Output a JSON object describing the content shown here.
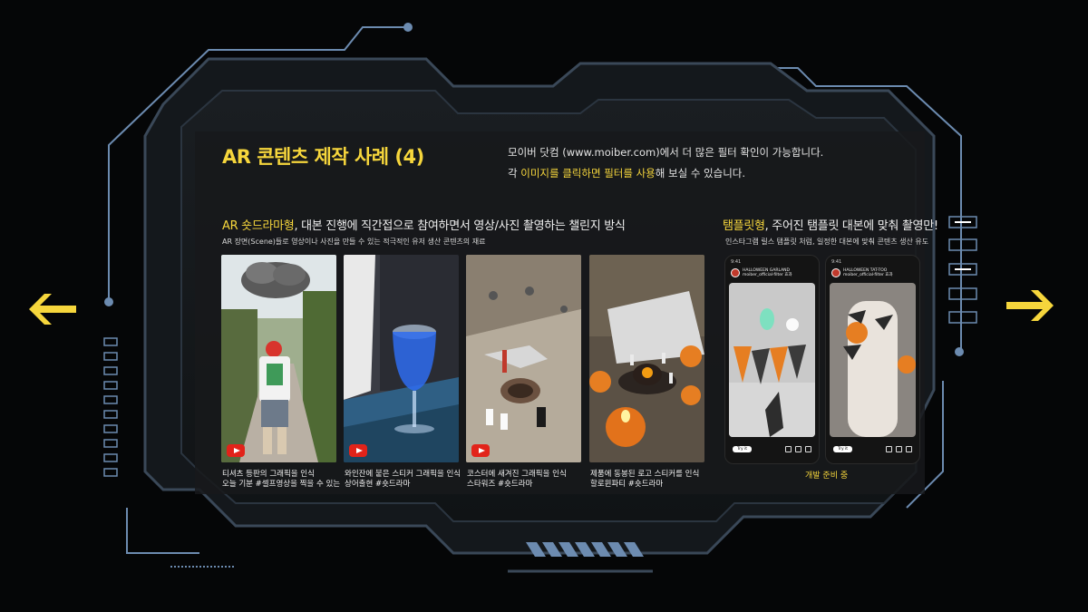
{
  "slide": {
    "title": "AR 콘텐츠 제작 사례 (4)",
    "header_line1": "모이버 닷컴 (www.moiber.com)에서 더 많은 필터 확인이 가능합니다.",
    "header_line2_prefix": "각 ",
    "header_line2_highlight": "이미지를 클릭하면 필터를 사용",
    "header_line2_suffix": "해 보실 수 있습니다."
  },
  "left_section": {
    "title_highlight": "AR 숏드라마형",
    "title_rest": ", 대본 진행에 직간접으로 참여하면서 영상/사진 촬영하는 챌린지 방식",
    "subtitle": "AR 장면(Scene)들로 영상이나 사진을 만들 수 있는 적극적인 유저 생산 콘텐츠의 재료",
    "cards": [
      {
        "caption_line1": "티셔츠 등판의 그래픽을 인식",
        "caption_line2": "오늘 기분 #셀프영상을 찍을 수 있는"
      },
      {
        "caption_line1": "와인잔에 붙은 스티커 그래픽을 인식",
        "caption_line2": "상어출현 #숏드라마"
      },
      {
        "caption_line1": "코스터에 새겨진 그래픽을 인식",
        "caption_line2": "스타워즈 #숏드라마"
      },
      {
        "caption_line1": "제품에 동봉된 로고 스티커를 인식",
        "caption_line2": "할로윈파티 #숏드라마"
      }
    ]
  },
  "right_section": {
    "title_highlight": "탬플릿형",
    "title_rest": ", 주어진 탬플릿 대본에 맞춰 촬영만!",
    "subtitle": "인스타그램 릴스 탬플릿 처럼, 일정한 대본에 맞춰 콘텐츠 생산 유도",
    "phones": [
      {
        "time": "9:41",
        "account": "HALLOWEEN GARLAND",
        "handle": "moiber_official·filter 효과",
        "try_label": "Try it"
      },
      {
        "time": "9:41",
        "account": "HALLOWEEN TAT-TOO",
        "handle": "moiber_official·filter 효과",
        "try_label": "Try it"
      }
    ],
    "status": "개발 준비 중"
  },
  "colors": {
    "accent": "#f6d63c",
    "frame": "#3a4858",
    "frame_light": "#6c8bb0",
    "youtube": "#e2231a",
    "background": "#050607"
  },
  "icons": {
    "prev": "left-arrow-icon",
    "next": "right-arrow-icon",
    "video": "youtube-play-icon"
  }
}
